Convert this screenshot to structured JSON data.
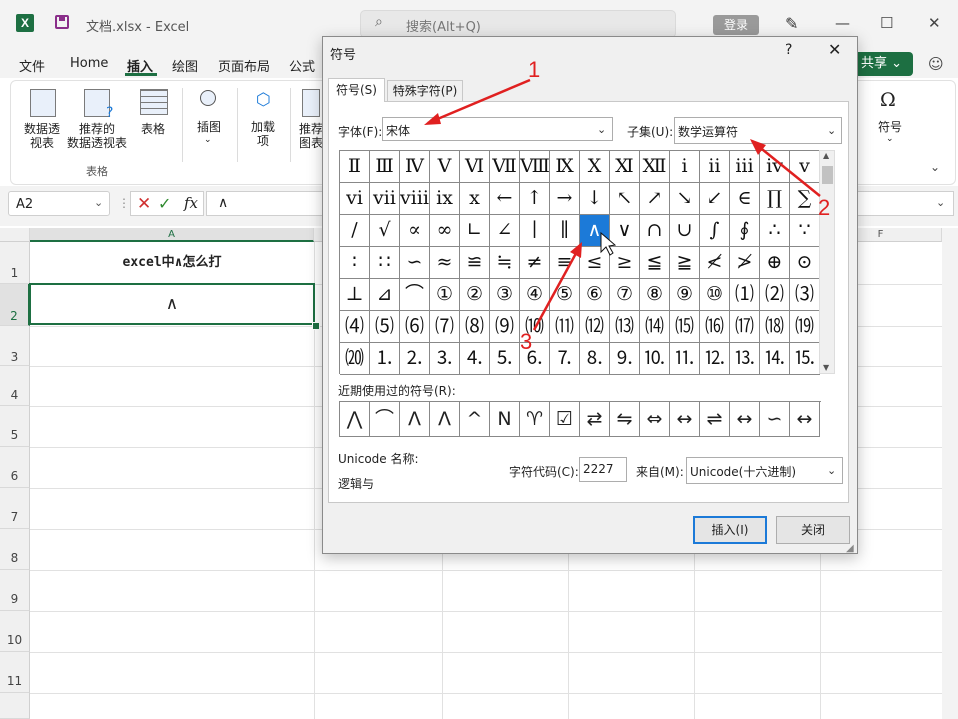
{
  "window": {
    "title": "文档.xlsx  -  Excel",
    "search_placeholder": "搜索(Alt+Q)",
    "login": "登录",
    "app_icon": "X",
    "minimize": "—",
    "maximize": "☐",
    "close": "✕"
  },
  "menu": {
    "items": [
      "文件",
      "Home",
      "插入",
      "绘图",
      "页面布局",
      "公式"
    ],
    "active": "插入",
    "share": "共享"
  },
  "ribbon": {
    "pivot_table": "数据透\n视表",
    "recommended_pivot": "推荐的\n数据透视表",
    "table": "表格",
    "illustrations": "插图",
    "addins": "加载\n项",
    "recommended_charts": "推荐\n图表",
    "symbols": "符号",
    "group_tables": "表格"
  },
  "formula_bar": {
    "name_box": "A2",
    "formula": "∧",
    "fx": "fx"
  },
  "sheet": {
    "columns": [
      "A",
      "F"
    ],
    "rows": [
      "1",
      "2",
      "3",
      "4",
      "5",
      "6",
      "7",
      "8",
      "9",
      "10",
      "11"
    ],
    "A1": "excel中∧怎么打",
    "A2": "∧"
  },
  "dialog": {
    "title": "符号",
    "help": "?",
    "close": "✕",
    "tab_symbols": "符号(S)",
    "tab_special": "特殊字符(P)",
    "font_label": "字体(F):",
    "font_value": "宋体",
    "subset_label": "子集(U):",
    "subset_value": "数学运算符",
    "grid": [
      [
        "Ⅱ",
        "Ⅲ",
        "Ⅳ",
        "Ⅴ",
        "Ⅵ",
        "Ⅶ",
        "Ⅷ",
        "Ⅸ",
        "Ⅹ",
        "Ⅺ",
        "Ⅻ",
        "ⅰ",
        "ⅱ",
        "ⅲ",
        "ⅳ",
        "ⅴ"
      ],
      [
        "ⅵ",
        "ⅶ",
        "ⅷ",
        "ⅸ",
        "ⅹ",
        "←",
        "↑",
        "→",
        "↓",
        "↖",
        "↗",
        "↘",
        "↙",
        "∈",
        "∏",
        "∑"
      ],
      [
        "∕",
        "√",
        "∝",
        "∞",
        "∟",
        "∠",
        "∣",
        "∥",
        "∧",
        "∨",
        "∩",
        "∪",
        "∫",
        "∮",
        "∴",
        "∵"
      ],
      [
        "∶",
        "∷",
        "∽",
        "≈",
        "≌",
        "≒",
        "≠",
        "≡",
        "≤",
        "≥",
        "≦",
        "≧",
        "≮",
        "≯",
        "⊕",
        "⊙"
      ],
      [
        "⊥",
        "⊿",
        "⌒",
        "①",
        "②",
        "③",
        "④",
        "⑤",
        "⑥",
        "⑦",
        "⑧",
        "⑨",
        "⑩",
        "⑴",
        "⑵",
        "⑶"
      ],
      [
        "⑷",
        "⑸",
        "⑹",
        "⑺",
        "⑻",
        "⑼",
        "⑽",
        "⑾",
        "⑿",
        "⒀",
        "⒁",
        "⒂",
        "⒃",
        "⒄",
        "⒅",
        "⒆"
      ],
      [
        "⒇",
        "⒈",
        "⒉",
        "⒊",
        "⒋",
        "⒌",
        "⒍",
        "⒎",
        "⒏",
        "⒐",
        "⒑",
        "⒒",
        "⒓",
        "⒔",
        "⒕",
        "⒖"
      ]
    ],
    "selected_symbol": "∧",
    "recent_label": "近期使用过的符号(R):",
    "recent": [
      "⋀",
      "⌒",
      "Λ",
      "Λ",
      "^",
      "N",
      "♈",
      "☑",
      "⇄",
      "⇋",
      "⇔",
      "↔",
      "⇌",
      "↔",
      "∽",
      "↔"
    ],
    "unicode_name_label": "Unicode 名称:",
    "unicode_name_value": "逻辑与",
    "char_code_label": "字符代码(C):",
    "char_code_value": "2227",
    "from_label": "来自(M):",
    "from_value": "Unicode(十六进制)",
    "insert_button": "插入(I)",
    "close_button": "关闭"
  },
  "annotations": [
    "1",
    "2",
    "3"
  ],
  "colors": {
    "excel_green": "#1d6f42",
    "selection_blue": "#1c7ad8",
    "annotation_red": "#e02020"
  }
}
